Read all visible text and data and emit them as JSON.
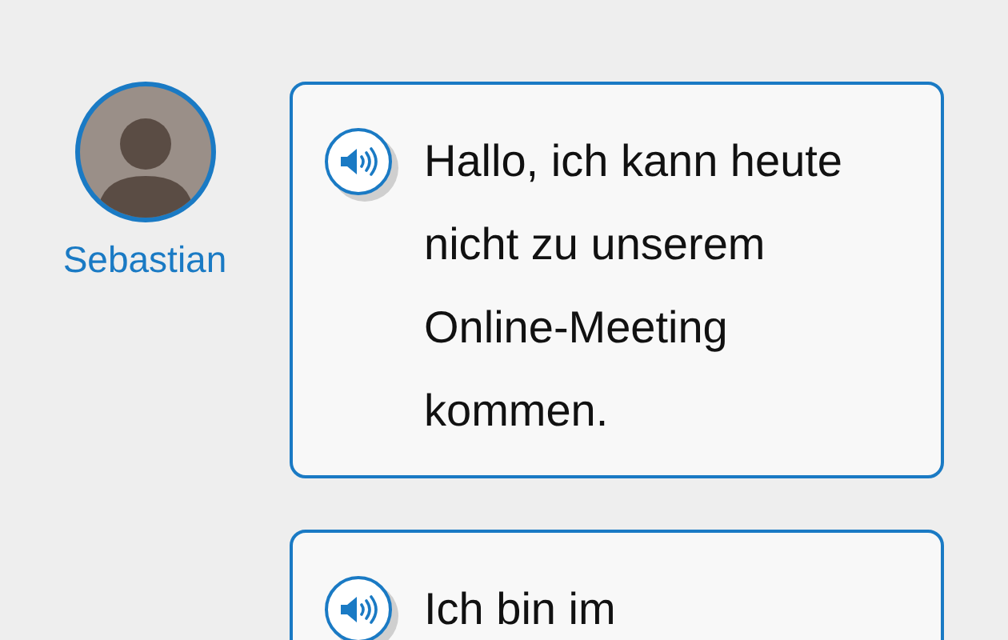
{
  "messages": [
    {
      "sender": "Sebastian",
      "text": "Hallo, ich kann heute nicht zu unserem Online-Meeting kommen."
    },
    {
      "text": "Ich bin im"
    }
  ]
}
